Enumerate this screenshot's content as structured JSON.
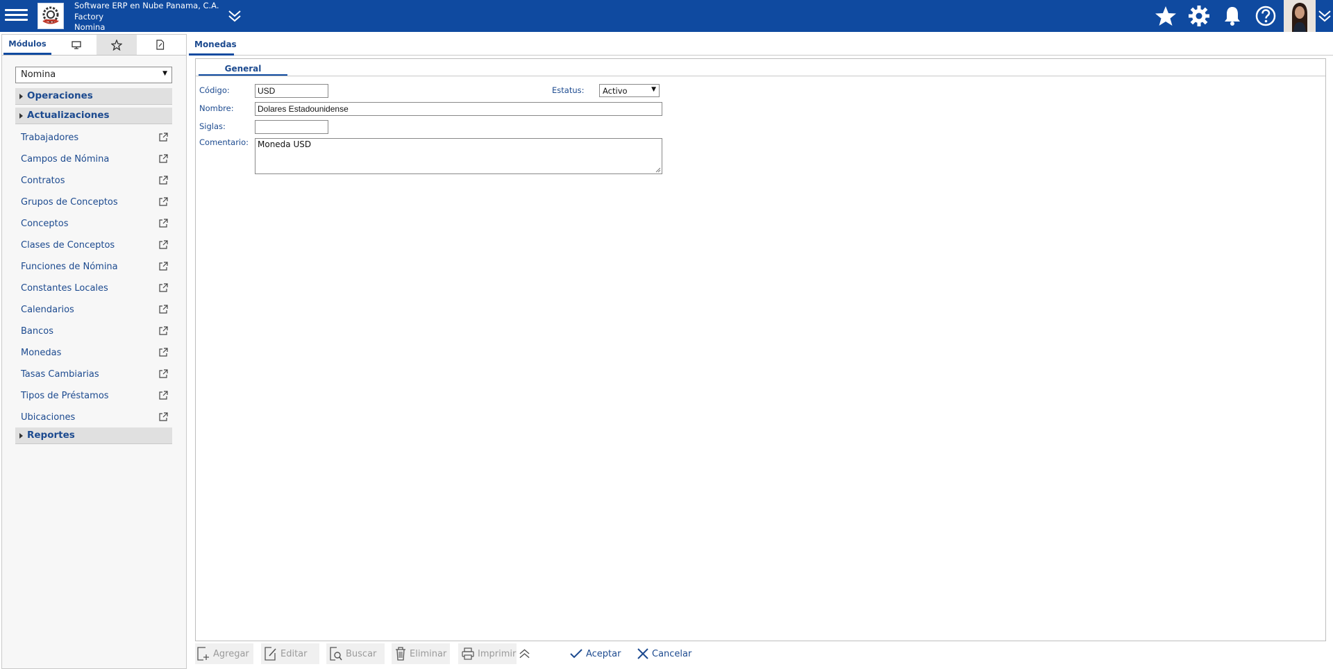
{
  "header": {
    "company_line1": "Software ERP en Nube Panama, C.A.",
    "company_line2": "Factory",
    "company_line3": "Nomina"
  },
  "sidebar": {
    "tabs": [
      {
        "label": "Módulos",
        "icon": "modules-label"
      },
      {
        "label": "",
        "icon": "monitor-icon"
      },
      {
        "label": "",
        "icon": "star-icon"
      },
      {
        "label": "",
        "icon": "document-icon"
      }
    ],
    "module_selected": "Nomina",
    "sections": {
      "operaciones": "Operaciones",
      "actualizaciones": "Actualizaciones",
      "reportes": "Reportes"
    },
    "items": [
      {
        "label": "Trabajadores"
      },
      {
        "label": "Campos de Nómina"
      },
      {
        "label": "Contratos"
      },
      {
        "label": "Grupos de Conceptos"
      },
      {
        "label": "Conceptos"
      },
      {
        "label": "Clases de Conceptos"
      },
      {
        "label": "Funciones de Nómina"
      },
      {
        "label": "Constantes Locales"
      },
      {
        "label": "Calendarios"
      },
      {
        "label": "Bancos"
      },
      {
        "label": "Monedas"
      },
      {
        "label": "Tasas Cambiarias"
      },
      {
        "label": "Tipos de Préstamos"
      },
      {
        "label": "Ubicaciones"
      }
    ]
  },
  "main": {
    "tab": "Monedas",
    "subtab": "General",
    "form": {
      "codigo_label": "Código:",
      "codigo_value": "USD",
      "estatus_label": "Estatus:",
      "estatus_value": "Activo",
      "nombre_label": "Nombre:",
      "nombre_value": "Dolares Estadounidense",
      "siglas_label": "Siglas:",
      "siglas_value": "",
      "comentario_label": "Comentario:",
      "comentario_value": "Moneda USD"
    }
  },
  "toolbar": {
    "agregar": "Agregar",
    "editar": "Editar",
    "buscar": "Buscar",
    "eliminar": "Eliminar",
    "imprimir": "Imprimir",
    "aceptar": "Aceptar",
    "cancelar": "Cancelar"
  },
  "colors": {
    "header_bg": "#0f4aa0",
    "link": "#1c4a8f"
  }
}
